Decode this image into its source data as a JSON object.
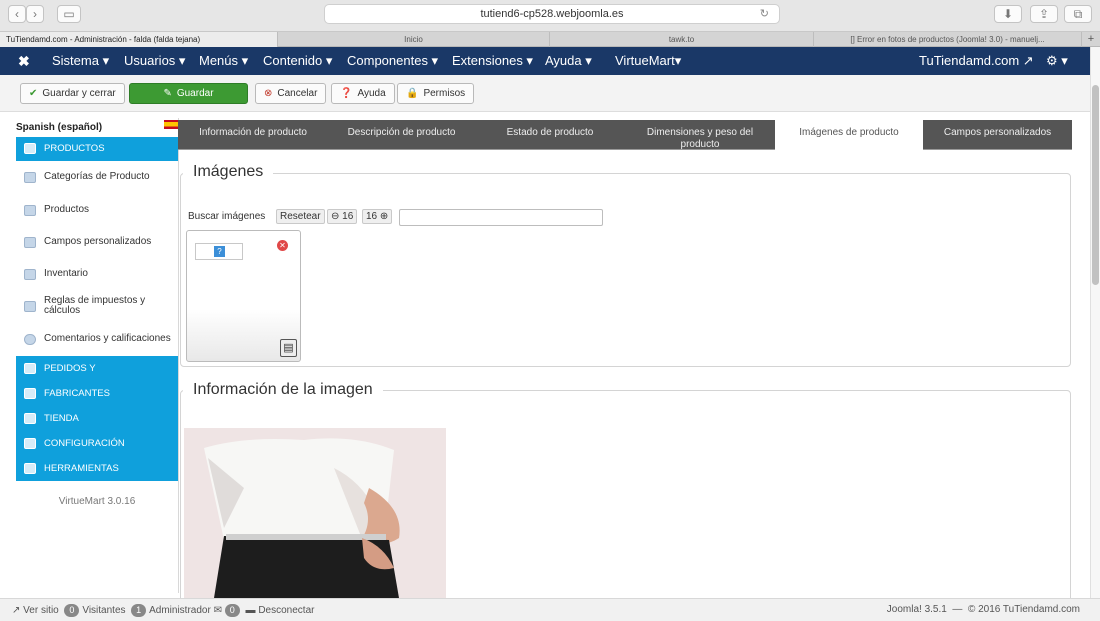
{
  "browser": {
    "url": "tutiend6-cp528.webjoomla.es",
    "tabs": [
      {
        "label": "TuTiendamd.com - Administración - falda (falda tejana)",
        "active": true
      },
      {
        "label": "Inicio",
        "active": false
      },
      {
        "label": "tawk.to",
        "active": false
      },
      {
        "label": "[] Error en fotos de productos (Joomla! 3.0) - manuelj...",
        "active": false
      }
    ],
    "new_tab": "+"
  },
  "nav": {
    "items": [
      "Sistema ▾",
      "Usuarios ▾",
      "Menús ▾",
      "Contenido ▾",
      "Componentes ▾",
      "Extensiones ▾",
      "Ayuda ▾",
      "VirtueMart▾"
    ],
    "site_link": "TuTiendamd.com ↗",
    "settings": "⚙ ▾"
  },
  "toolbar": {
    "save_close": "Guardar y cerrar",
    "save": "Guardar",
    "cancel": "Cancelar",
    "help": "Ayuda",
    "permissions": "Permisos"
  },
  "sidebar": {
    "language": "Spanish (español)",
    "section_products": "PRODUCTOS",
    "items": [
      "Categorías de Producto",
      "Productos",
      "Campos personalizados",
      "Inventario",
      "Reglas de impuestos y cálculos",
      "Comentarios y calificaciones"
    ],
    "sections": [
      "PEDIDOS Y",
      "FABRICANTES",
      "TIENDA",
      "CONFIGURACIÓN",
      "HERRAMIENTAS"
    ],
    "version": "VirtueMart 3.0.16"
  },
  "product_tabs": [
    {
      "label": "Información de producto",
      "active": false
    },
    {
      "label": "Descripción de producto",
      "active": false
    },
    {
      "label": "Estado de producto",
      "active": false
    },
    {
      "label": "Dimensiones y peso del producto",
      "active": false
    },
    {
      "label": "Imágenes de producto",
      "active": true
    },
    {
      "label": "Campos personalizados",
      "active": false
    }
  ],
  "images_panel": {
    "legend": "Imágenes",
    "search_label": "Buscar imágenes",
    "reset": "Resetear",
    "prev_count": "16",
    "next_count": "16",
    "search_value": ""
  },
  "image_info": {
    "legend": "Información de la imagen"
  },
  "footer": {
    "view_site": "Ver sitio",
    "visitors_count": "0",
    "visitors": "Visitantes",
    "admin_count": "1",
    "admin": "Administrador",
    "messages_count": "0",
    "logout": "Desconectar",
    "copyright": "Joomla! 3.5.1  —  © 2016 TuTiendamd.com"
  },
  "colors": {
    "nav": "#1a3867",
    "sidebar_active": "#0fa0dc",
    "save": "#3d9a33",
    "tabs_bg": "#555555"
  }
}
